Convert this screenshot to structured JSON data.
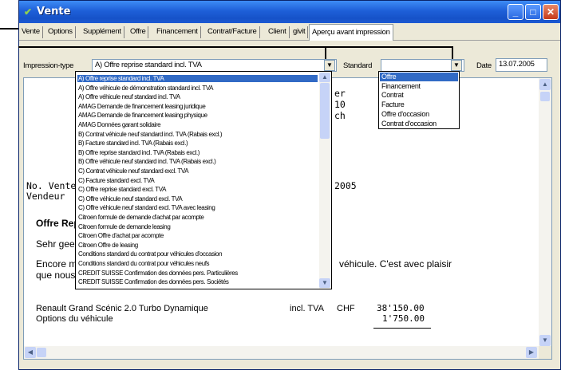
{
  "window": {
    "title": "Vente"
  },
  "tabs": [
    {
      "label": "Vente"
    },
    {
      "label": "Options"
    },
    {
      "label": "Supplément"
    },
    {
      "label": "Offre"
    },
    {
      "label": "Financement"
    },
    {
      "label": "Contrat/Facture"
    },
    {
      "label": "Client"
    },
    {
      "label": "givit"
    },
    {
      "label": "Aperçu avant impression"
    }
  ],
  "form": {
    "type_label": "Impression-type",
    "type_value": "A) Offre reprise standard incl. TVA",
    "standard_label": "Standard",
    "standard_value": "",
    "date_label": "Date",
    "date_value": "13.07.2005"
  },
  "type_options": [
    "A) Offre reprise standard incl. TVA",
    "A) Offre véhicule de démonstration standard incl. TVA",
    "A) Offre véhicule neuf standard incl. TVA",
    "AMAG Demande de financement leasing juridique",
    "AMAG Demande de financement leasing physique",
    "AMAG Données garant solidaire",
    "B) Contrat véhicule neuf standard incl. TVA (Rabais excl.)",
    "B) Facture standard incl. TVA (Rabais excl.)",
    "B) Offre reprise standard incl. TVA (Rabais excl.)",
    "B) Offre véhicule neuf standard incl. TVA (Rabais excl.)",
    "C) Contrat véhicule neuf standard excl. TVA",
    "C) Facture standard excl. TVA",
    "C) Offre reprise standard excl. TVA",
    "C) Offre véhicule neuf standard excl. TVA",
    "C) Offre véhicule neuf standard excl. TVA avec leasing",
    "Citroen formule de demande d'achat par acompte",
    "Citroen formule de demande leasing",
    "Citroen Offre d'achat par acompte",
    "Citroen Offre de leasing",
    "Conditions standard du contrat pour véhicules d'occasion",
    "Conditions standard du contrat pour véhicules neufs",
    "CREDIT SUISSE Confirmation des données pers. Particulières",
    "CREDIT SUISSE Confirmation des données pers. Sociétés"
  ],
  "standard_options": [
    "Offre",
    "Financement",
    "Contrat",
    "Facture",
    "Offre d'occasion",
    "Contrat d'occasion"
  ],
  "preview": {
    "frag1": "er",
    "frag2": "10",
    "frag3": "ch",
    "no_vente": "No. Vente",
    "vendeur": "Vendeur",
    "year": "2005",
    "offre_title": "Offre Repris",
    "greeting": "Sehr geehrter",
    "encore": "Encore merci",
    "encore_tail": "véhicule. C'est avec plaisir",
    "line_que": "que nous vous proposons ci-dessous notre offre de reprise.",
    "vehicle": "Renault Grand Scénic 2.0 Turbo Dynamique",
    "tva": "incl. TVA",
    "currency": "CHF",
    "vehicle_price": "38'150.00",
    "options": "Options du véhicule",
    "options_price": "1'750.00"
  },
  "icons": {
    "app": "car-icon",
    "minimize": "minimize-icon",
    "maximize": "maximize-icon",
    "close": "close-icon"
  }
}
